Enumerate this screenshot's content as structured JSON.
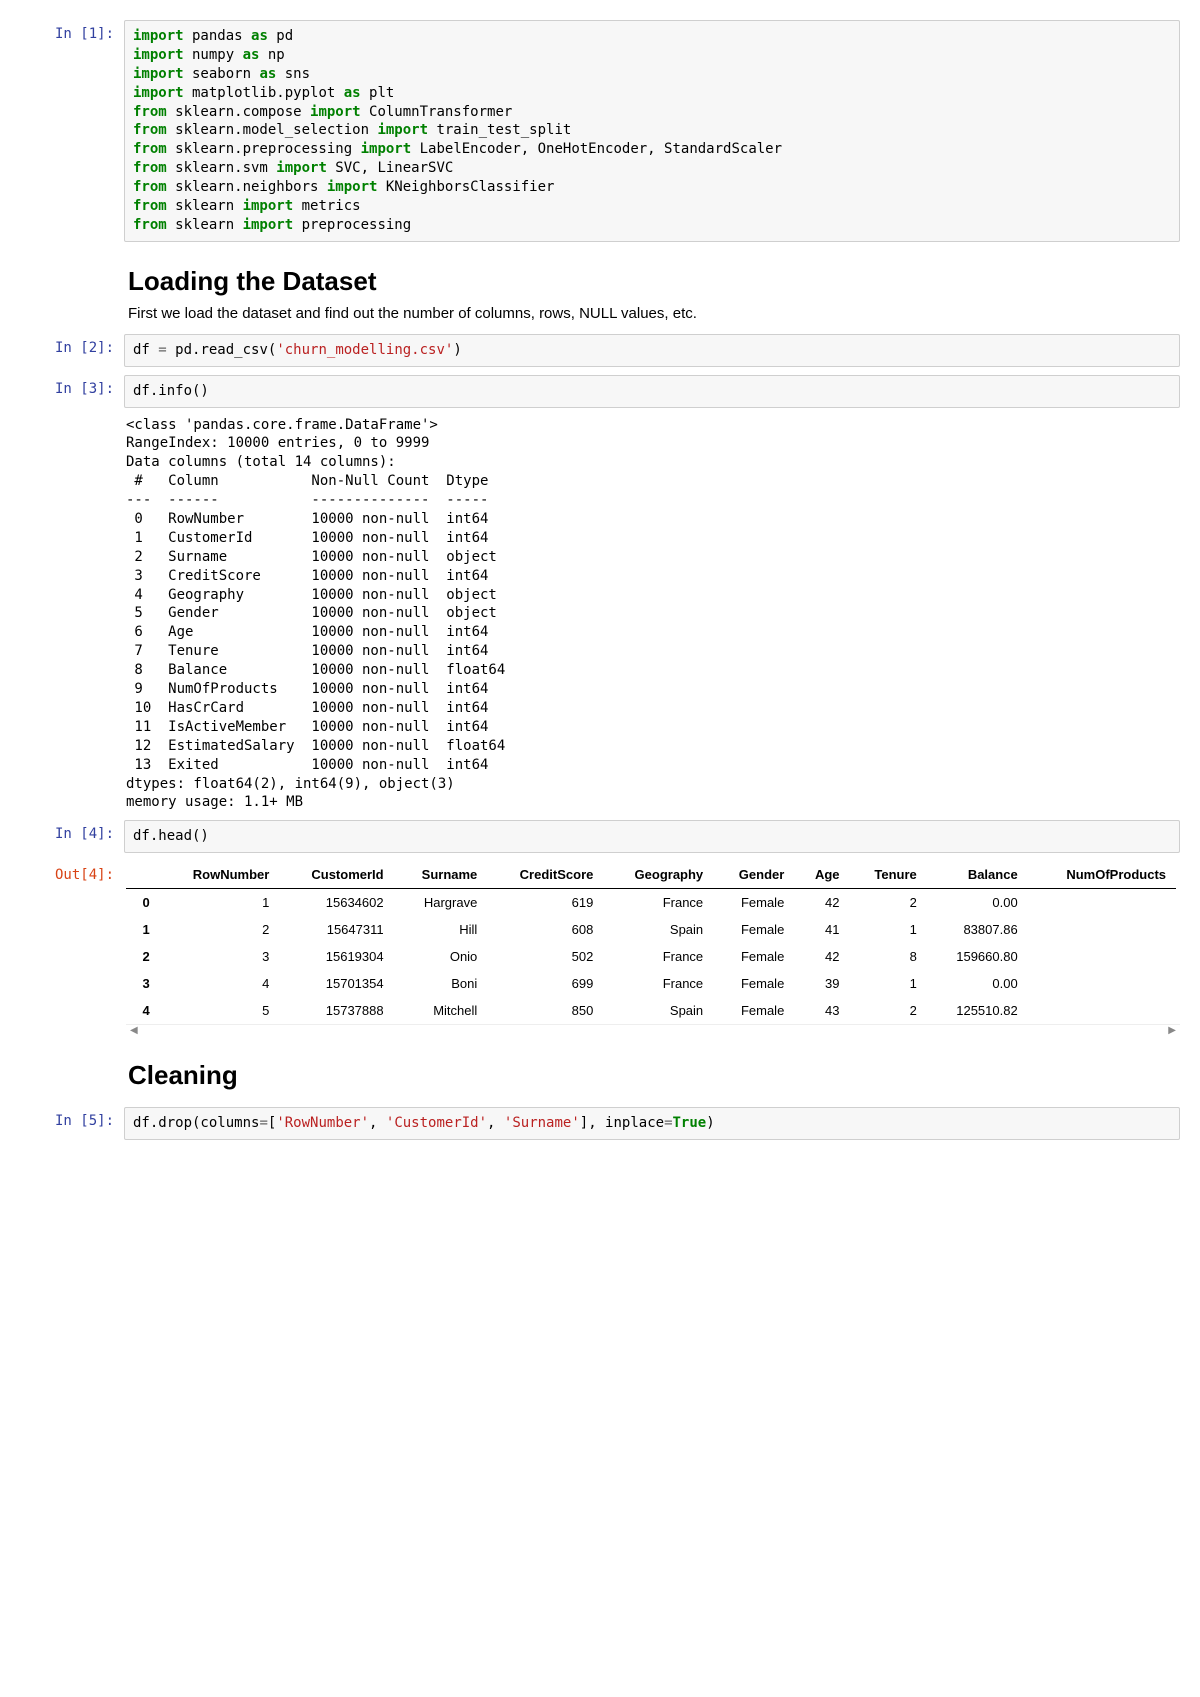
{
  "prompts": {
    "in": "In [",
    "out": "Out[",
    "close": "]:"
  },
  "cells": {
    "c1": {
      "n": "1"
    },
    "c2": {
      "n": "2"
    },
    "c3": {
      "n": "3"
    },
    "c4": {
      "n": "4"
    },
    "c5": {
      "n": "5"
    }
  },
  "md1": {
    "heading": "Loading the Dataset",
    "para": "First we load the dataset and find out the number of columns, rows, NULL values, etc."
  },
  "md2": {
    "heading": "Cleaning"
  },
  "code1_tokens": {
    "import": "import",
    "as": "as",
    "from": "from",
    "pandas": " pandas ",
    "pd": " pd",
    "numpy": " numpy ",
    "np": " np",
    "seaborn": " seaborn ",
    "sns": " sns",
    "mpl": " matplotlib.pyplot ",
    "plt": " plt",
    "compose": " sklearn.compose ",
    "ct": " ColumnTransformer",
    "modelsel": " sklearn.model_selection ",
    "tts": " train_test_split",
    "preproc": " sklearn.preprocessing ",
    "encs": " LabelEncoder, OneHotEncoder, StandardScaler",
    "svm": " sklearn.svm ",
    "svc": " SVC, LinearSVC",
    "neighbors": " sklearn.neighbors ",
    "knn": " KNeighborsClassifier",
    "sklearn": " sklearn ",
    "metrics": " metrics",
    "preprocessing": " preprocessing"
  },
  "code2": {
    "pre": "df ",
    "eq": "=",
    "mid": " pd.read_csv(",
    "str": "'churn_modelling.csv'",
    "post": ")"
  },
  "code3": {
    "text": "df.info()"
  },
  "info_output": "<class 'pandas.core.frame.DataFrame'>\nRangeIndex: 10000 entries, 0 to 9999\nData columns (total 14 columns):\n #   Column           Non-Null Count  Dtype  \n---  ------           --------------  -----  \n 0   RowNumber        10000 non-null  int64  \n 1   CustomerId       10000 non-null  int64  \n 2   Surname          10000 non-null  object \n 3   CreditScore      10000 non-null  int64  \n 4   Geography        10000 non-null  object \n 5   Gender           10000 non-null  object \n 6   Age              10000 non-null  int64  \n 7   Tenure           10000 non-null  int64  \n 8   Balance          10000 non-null  float64\n 9   NumOfProducts    10000 non-null  int64  \n 10  HasCrCard        10000 non-null  int64  \n 11  IsActiveMember   10000 non-null  int64  \n 12  EstimatedSalary  10000 non-null  float64\n 13  Exited           10000 non-null  int64  \ndtypes: float64(2), int64(9), object(3)\nmemory usage: 1.1+ MB",
  "code4": {
    "text": "df.head()"
  },
  "table": {
    "columns": [
      "RowNumber",
      "CustomerId",
      "Surname",
      "CreditScore",
      "Geography",
      "Gender",
      "Age",
      "Tenure",
      "Balance",
      "NumOfProducts"
    ],
    "index": [
      "0",
      "1",
      "2",
      "3",
      "4"
    ],
    "rows": [
      [
        "1",
        "15634602",
        "Hargrave",
        "619",
        "France",
        "Female",
        "42",
        "2",
        "0.00",
        ""
      ],
      [
        "2",
        "15647311",
        "Hill",
        "608",
        "Spain",
        "Female",
        "41",
        "1",
        "83807.86",
        ""
      ],
      [
        "3",
        "15619304",
        "Onio",
        "502",
        "France",
        "Female",
        "42",
        "8",
        "159660.80",
        ""
      ],
      [
        "4",
        "15701354",
        "Boni",
        "699",
        "France",
        "Female",
        "39",
        "1",
        "0.00",
        ""
      ],
      [
        "5",
        "15737888",
        "Mitchell",
        "850",
        "Spain",
        "Female",
        "43",
        "2",
        "125510.82",
        ""
      ]
    ]
  },
  "code5": {
    "pre": "df.drop(columns",
    "eq": "=",
    "br": "[",
    "s1": "'RowNumber'",
    "s2": "'CustomerId'",
    "s3": "'Surname'",
    "mid": "], inplace",
    "true": "True",
    "post": ")"
  },
  "scroll": {
    "left": "◀",
    "right": "▶"
  }
}
